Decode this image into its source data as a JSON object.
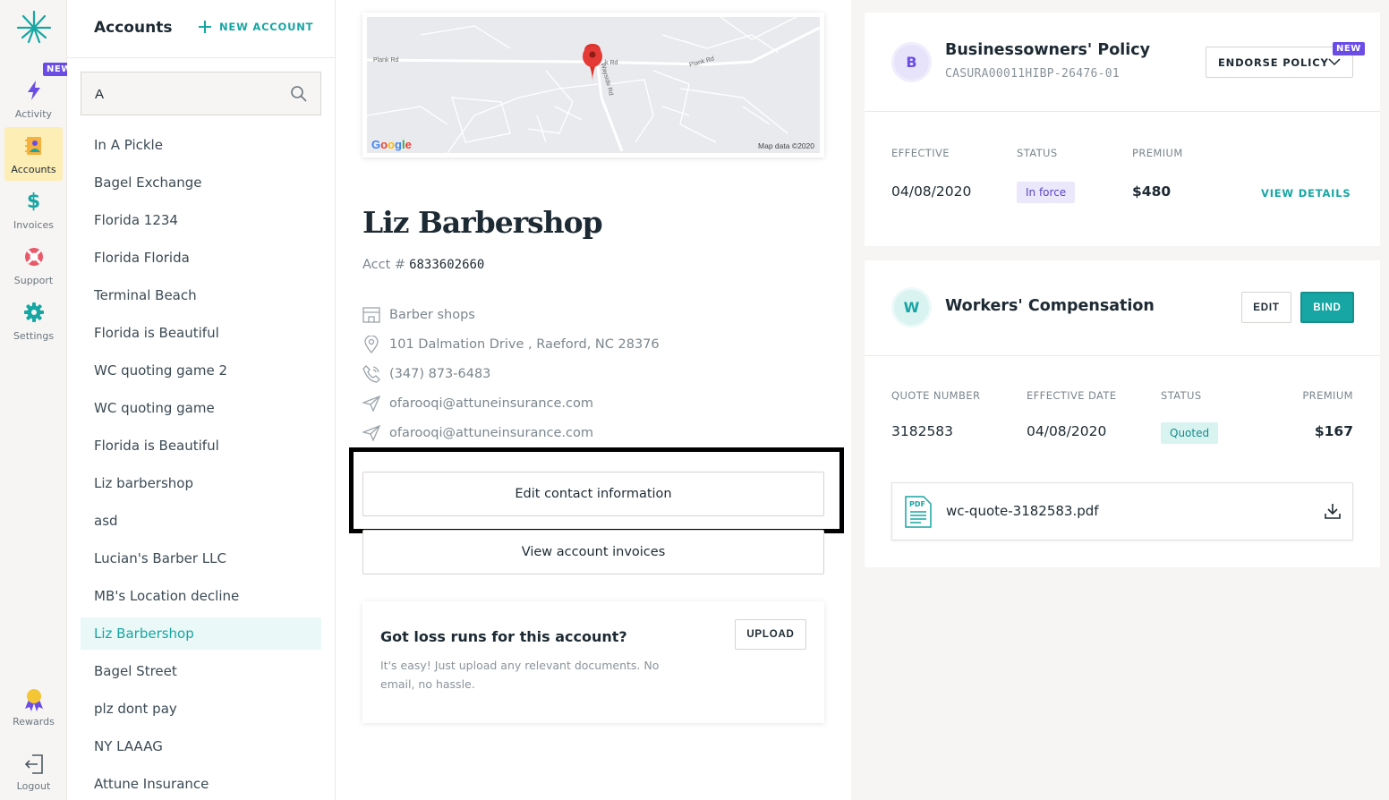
{
  "nav": {
    "new_badge": "NEW",
    "items": [
      {
        "label": "Activity",
        "icon": "bolt-icon"
      },
      {
        "label": "Accounts",
        "icon": "accounts-book-icon"
      },
      {
        "label": "Invoices",
        "icon": "dollar-icon"
      },
      {
        "label": "Support",
        "icon": "lifebuoy-icon"
      },
      {
        "label": "Settings",
        "icon": "gear-icon"
      }
    ],
    "rewards_label": "Rewards",
    "logout_label": "Logout"
  },
  "accounts": {
    "title": "Accounts",
    "new_account_label": "NEW ACCOUNT",
    "search_value": "A",
    "list": [
      "In A Pickle",
      "Bagel Exchange",
      "Florida 1234",
      "Florida Florida",
      "Terminal Beach",
      "Florida is Beautiful",
      "WC quoting game 2",
      "WC quoting game",
      "Florida is Beautiful",
      "Liz barbershop",
      "asd",
      "Lucian's Barber LLC",
      "MB's Location decline",
      "Liz Barbershop",
      "Bagel Street",
      "plz dont pay",
      "NY LAAAG",
      "Attune Insurance"
    ],
    "selected_index": 13
  },
  "detail": {
    "map": {
      "google_label": "Google",
      "map_data_label": "Map data ©2020",
      "road_labels": [
        "Plank Rd",
        "Plank Rd",
        "k Rd",
        "Wayside Rd"
      ]
    },
    "business_name": "Liz Barbershop",
    "acct_prefix": "Acct #",
    "acct_number": "6833602660",
    "industry": "Barber shops",
    "address": "101 Dalmation Drive , Raeford, NC 28376",
    "phone": "(347) 873-6483",
    "email_1": "ofarooqi@attuneinsurance.com",
    "email_2": "ofarooqi@attuneinsurance.com",
    "edit_contact_label": "Edit contact information",
    "view_invoices_label": "View account invoices",
    "loss_runs": {
      "heading": "Got loss runs for this account?",
      "text": "It's easy! Just upload any relevant documents. No email, no hassle.",
      "upload_label": "UPLOAD"
    }
  },
  "bop": {
    "avatar": "B",
    "name": "Businessowners' Policy",
    "policy_id": "CASURA00011HIBP-26476-01",
    "endorse_label": "ENDORSE POLICY",
    "new_badge": "NEW",
    "labels": {
      "effective": "EFFECTIVE",
      "status": "STATUS",
      "premium": "PREMIUM"
    },
    "effective": "04/08/2020",
    "status": "In force",
    "premium": "$480",
    "view_details_label": "VIEW DETAILS"
  },
  "wc": {
    "avatar": "W",
    "name": "Workers' Compensation",
    "edit_label": "EDIT",
    "bind_label": "BIND",
    "labels": {
      "quote_number": "QUOTE NUMBER",
      "effective_date": "EFFECTIVE DATE",
      "status": "STATUS",
      "premium": "PREMIUM"
    },
    "quote_number": "3182583",
    "effective_date": "04/08/2020",
    "status": "Quoted",
    "premium": "$167",
    "file_name": "wc-quote-3182583.pdf",
    "file_icon_label": "PDF"
  },
  "colors": {
    "brand_teal": "#17a6a3",
    "new_badge_purple": "#6b4de6",
    "active_nav_bg": "#fdeeb6",
    "panel_bg": "#f6f5f3"
  }
}
